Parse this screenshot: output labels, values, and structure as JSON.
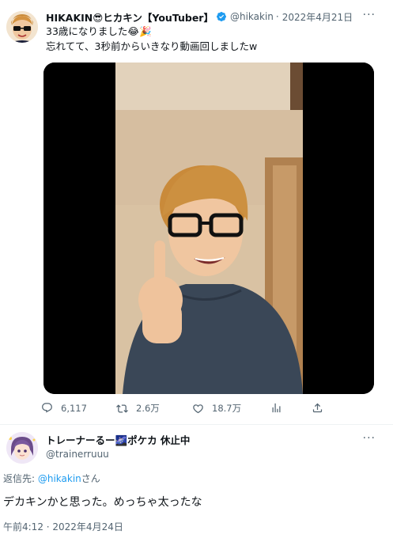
{
  "main_tweet": {
    "display_name": "HIKAKIN😎ヒカキン【YouTuber】",
    "handle": "@hikakin",
    "separator": "·",
    "date": "2022年4月21日",
    "text_line1": "33歳になりました😂🎉",
    "text_line2": "忘れてて、3秒前からいきなり動画回しましたw",
    "more_label": "···",
    "actions": {
      "replies": "6,117",
      "retweets": "2.6万",
      "likes": "18.7万"
    }
  },
  "reply_tweet": {
    "display_name": "トレーナーるー🌌ポケカ 休止中",
    "handle": "@trainerruuu",
    "replying_prefix": "返信先: ",
    "replying_mention": "@hikakin",
    "replying_suffix": "さん",
    "text": "デカキンかと思った。めっちゃ太ったな",
    "timestamp": "午前4:12 · 2022年4月24日",
    "more_label": "···"
  },
  "colors": {
    "accent": "#1d9bf0",
    "secondary_text": "#536471",
    "primary_text": "#0f1419",
    "divider": "#eff3f4"
  },
  "icons": [
    "verified-badge-icon",
    "reply-icon",
    "retweet-icon",
    "like-icon",
    "analytics-icon",
    "share-icon",
    "more-icon"
  ]
}
